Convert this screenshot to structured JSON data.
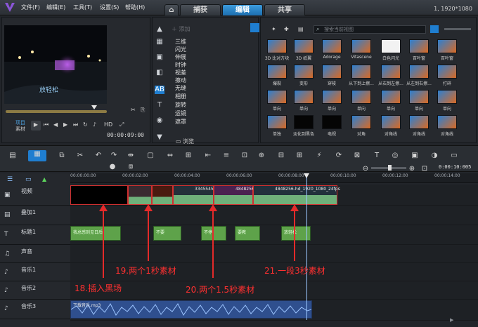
{
  "menu": [
    "文件(F)",
    "编辑(E)",
    "工具(T)",
    "设置(S)",
    "帮助(H)"
  ],
  "tabs": {
    "home": "⌂",
    "capture": "捕获",
    "edit": "编辑",
    "share": "共享"
  },
  "resolution": "1, 1920*1080",
  "preview": {
    "caption": "放轻松",
    "mode_project": "项目",
    "mode_clip": "素材",
    "hd": "HD",
    "timecode": "00:00:09:00"
  },
  "effects": {
    "add_label": "添加",
    "categories": [
      "三维",
      "闪光",
      "伸展",
      "时钟",
      "视差",
      "擦动",
      "无缝",
      "相册",
      "旋转",
      "运镜",
      "遮罩"
    ],
    "browse": "浏览"
  },
  "library": {
    "search_placeholder": "搜索当前视图",
    "rows": [
      [
        "3D 比对方块",
        "3D 纸翼",
        "Adorage",
        "Vitascene",
        "白色闪光",
        "百叶窗",
        "百叶窗"
      ],
      [
        "爆裂",
        "变形",
        "穿梭",
        "从下到上擦...",
        "从右到左擦...",
        "从左到右擦...",
        "打碎"
      ],
      [
        "单向",
        "单向",
        "单向",
        "单向",
        "单向",
        "单向",
        "单向"
      ],
      [
        "单独",
        "淡化到黑色",
        "电视",
        "对角",
        "对角线",
        "对角线",
        "对角线"
      ]
    ]
  },
  "timeline": {
    "time_display": "0:00:10:005",
    "ruler": [
      "00:00:00:00",
      "00:00:02:00",
      "00:00:04:00",
      "00:00:06:00",
      "00:00:08:00",
      "00:00:10:00",
      "00:00:12:00",
      "00:00:14:00"
    ],
    "tracks": [
      "视频",
      "叠加1",
      "标题1",
      "声音",
      "音乐1",
      "音乐2",
      "音乐3"
    ],
    "clips": {
      "c3": "3345545",
      "c4": "4848256",
      "c5": "4848256-hd_1920_1080_24fps"
    },
    "titles": [
      "我总感到见日后",
      "不要",
      "不停",
      "要教",
      "放轻松"
    ],
    "music": "下载音乐.mp3"
  },
  "annotations": {
    "a18": "18.插入黑场",
    "a19": "19.两个1秒素材",
    "a20": "20.两个1.5秒素材",
    "a21": "21.一段3秒素材"
  },
  "colors": {
    "accent": "#1f7ed0",
    "annotation": "#e42a2a",
    "title_clip": "#5ea24a"
  }
}
